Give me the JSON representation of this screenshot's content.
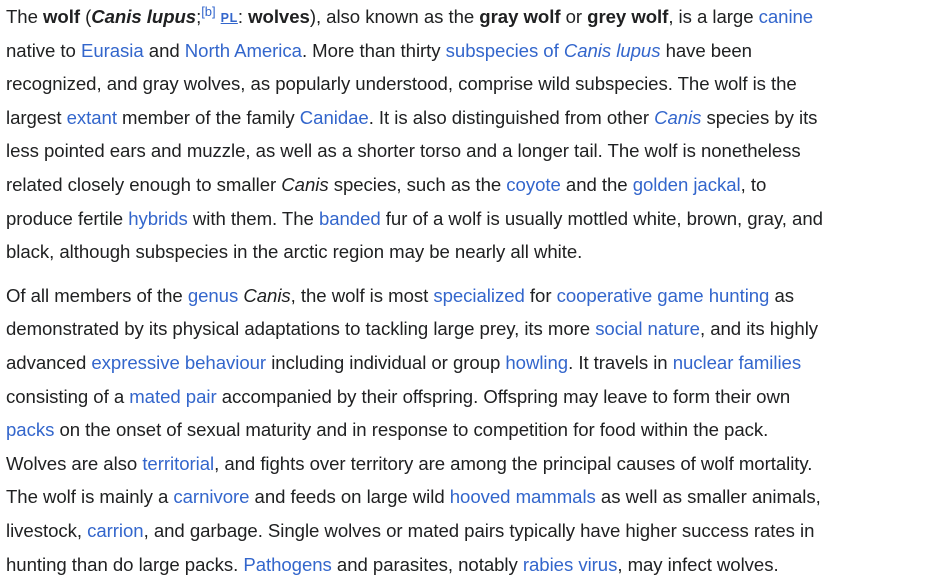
{
  "paragraphs": [
    {
      "lines": [
        [
          {
            "t": "The "
          },
          {
            "t": "wolf",
            "b": true
          },
          {
            "t": " ("
          },
          {
            "t": "Canis lupus",
            "b": true,
            "i": true
          },
          {
            "t": ";"
          },
          {
            "t": "[b]",
            "sup": true
          },
          {
            "t": " "
          },
          {
            "t": "PL",
            "pl": true
          },
          {
            "t": ": "
          },
          {
            "t": "wolves",
            "b": true
          },
          {
            "t": "), also known as the "
          },
          {
            "t": "gray wolf",
            "b": true
          },
          {
            "t": " or "
          },
          {
            "t": "grey wolf",
            "b": true
          },
          {
            "t": ", is a large "
          },
          {
            "t": "canine",
            "link": true
          }
        ],
        [
          {
            "t": "native to "
          },
          {
            "t": "Eurasia",
            "link": true
          },
          {
            "t": " and "
          },
          {
            "t": "North America",
            "link": true
          },
          {
            "t": ". More than thirty "
          },
          {
            "t": "subspecies of ",
            "link": true
          },
          {
            "t": "Canis lupus",
            "link": true,
            "i": true
          },
          {
            "t": " have been"
          }
        ],
        [
          {
            "t": "recognized, and gray wolves, as popularly understood, comprise wild subspecies. The wolf is the"
          }
        ],
        [
          {
            "t": "largest "
          },
          {
            "t": "extant",
            "link": true
          },
          {
            "t": " member of the family "
          },
          {
            "t": "Canidae",
            "link": true
          },
          {
            "t": ". It is also distinguished from other "
          },
          {
            "t": "Canis",
            "link": true,
            "i": true
          },
          {
            "t": " species by its"
          }
        ],
        [
          {
            "t": "less pointed ears and muzzle, as well as a shorter torso and a longer tail. The wolf is nonetheless"
          }
        ],
        [
          {
            "t": "related closely enough to smaller "
          },
          {
            "t": "Canis",
            "i": true
          },
          {
            "t": " species, such as the "
          },
          {
            "t": "coyote",
            "link": true
          },
          {
            "t": " and the "
          },
          {
            "t": "golden jackal",
            "link": true
          },
          {
            "t": ", to"
          }
        ],
        [
          {
            "t": "produce fertile "
          },
          {
            "t": "hybrids",
            "link": true
          },
          {
            "t": " with them. The "
          },
          {
            "t": "banded",
            "link": true
          },
          {
            "t": " fur of a wolf is usually mottled white, brown, gray, and"
          }
        ],
        [
          {
            "t": "black, although subspecies in the arctic region may be nearly all white."
          }
        ]
      ]
    },
    {
      "lines": [
        [
          {
            "t": "Of all members of the "
          },
          {
            "t": "genus",
            "link": true
          },
          {
            "t": " "
          },
          {
            "t": "Canis",
            "i": true
          },
          {
            "t": ", the wolf is most "
          },
          {
            "t": "specialized",
            "link": true
          },
          {
            "t": " for "
          },
          {
            "t": "cooperative game hunting",
            "link": true
          },
          {
            "t": " as"
          }
        ],
        [
          {
            "t": "demonstrated by its physical adaptations to tackling large prey, its more "
          },
          {
            "t": "social nature",
            "link": true
          },
          {
            "t": ", and its highly"
          }
        ],
        [
          {
            "t": "advanced "
          },
          {
            "t": "expressive behaviour",
            "link": true
          },
          {
            "t": " including individual or group "
          },
          {
            "t": "howling",
            "link": true
          },
          {
            "t": ". It travels in "
          },
          {
            "t": "nuclear families",
            "link": true
          }
        ],
        [
          {
            "t": "consisting of a "
          },
          {
            "t": "mated pair",
            "link": true
          },
          {
            "t": " accompanied by their offspring. Offspring may leave to form their own"
          }
        ],
        [
          {
            "t": "packs",
            "link": true
          },
          {
            "t": " on the onset of sexual maturity and in response to competition for food within the pack."
          }
        ],
        [
          {
            "t": "Wolves are also "
          },
          {
            "t": "territorial",
            "link": true
          },
          {
            "t": ", and fights over territory are among the principal causes of wolf mortality."
          }
        ],
        [
          {
            "t": "The wolf is mainly a "
          },
          {
            "t": "carnivore",
            "link": true
          },
          {
            "t": " and feeds on large wild "
          },
          {
            "t": "hooved mammals",
            "link": true
          },
          {
            "t": " as well as smaller animals,"
          }
        ],
        [
          {
            "t": "livestock, "
          },
          {
            "t": "carrion",
            "link": true
          },
          {
            "t": ", and garbage. Single wolves or mated pairs typically have higher success rates in"
          }
        ],
        [
          {
            "t": "hunting than do large packs. "
          },
          {
            "t": "Pathogens",
            "link": true
          },
          {
            "t": " and parasites, notably "
          },
          {
            "t": "rabies virus",
            "link": true
          },
          {
            "t": ", may infect wolves."
          }
        ]
      ]
    }
  ]
}
